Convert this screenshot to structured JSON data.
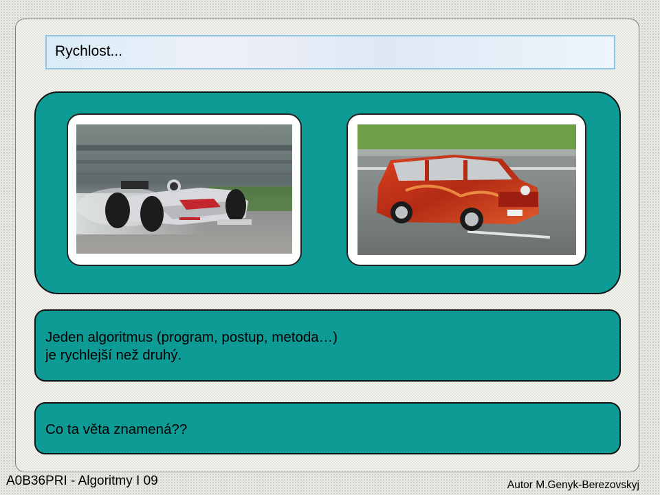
{
  "slide": {
    "title": "Rychlost...",
    "images": [
      {
        "name": "formula-car-photo",
        "icon": "racing-car-photo"
      },
      {
        "name": "trabant-car-photo",
        "icon": "trabant-photo"
      }
    ],
    "body_line1": "Jeden algoritmus (program, postup, metoda…)",
    "body_line2": "je rychlejší než druhý.",
    "question": "Co ta věta znamená??"
  },
  "footer": {
    "course": "A0B36PRI - Algoritmy I 09",
    "author": "Autor M.Genyk-Berezovskyj"
  },
  "colors": {
    "teal": "#0e9b95",
    "title_border": "#8fc4e6",
    "car_red": "#c0391b"
  }
}
